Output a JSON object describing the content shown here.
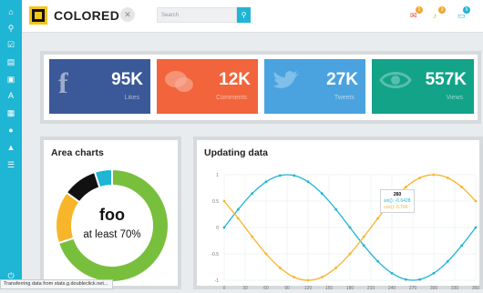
{
  "brand": {
    "name": "COLORED"
  },
  "search": {
    "placeholder": "Search"
  },
  "notifications": [
    {
      "icon": "mail-icon",
      "count": "2",
      "color": "#e84c3d"
    },
    {
      "icon": "bell-icon",
      "count": "3",
      "color": "#f0a92e"
    },
    {
      "icon": "chat-icon",
      "count": "9",
      "color": "#1fb5d4"
    }
  ],
  "sidebar": {
    "items": [
      "home-icon",
      "share-icon",
      "check-icon",
      "file-icon",
      "image-icon",
      "font-icon",
      "table-icon",
      "map-marker-icon",
      "warning-icon",
      "list-icon",
      "power-icon"
    ]
  },
  "stats": [
    {
      "value": "95K",
      "label": "Likes",
      "icon": "facebook-icon",
      "color": "#3b5998"
    },
    {
      "value": "12K",
      "label": "Comments",
      "icon": "comments-icon",
      "color": "#f2643b"
    },
    {
      "value": "27K",
      "label": "Tweets",
      "icon": "twitter-icon",
      "color": "#4aa3df"
    },
    {
      "value": "557K",
      "label": "Views",
      "icon": "eye-icon",
      "color": "#12a389"
    }
  ],
  "area_panel": {
    "title": "Area charts",
    "center_main": "foo",
    "center_sub": "at least 70%"
  },
  "updating_panel": {
    "title": "Updating data",
    "tooltip": {
      "x": "260",
      "sin": "sin(): -0.6428",
      "cos": "cos(): 0.766"
    }
  },
  "status_bar": {
    "text": "Transferring data from stats.g.doubleclick.net..."
  },
  "chart_data": [
    {
      "type": "pie",
      "title": "",
      "slices": [
        {
          "value": 70,
          "color": "#79bf3e"
        },
        {
          "value": 15,
          "color": "#f7b52a"
        },
        {
          "value": 10,
          "color": "#111111"
        },
        {
          "value": 5,
          "color": "#1fb5d4"
        }
      ]
    },
    {
      "type": "line",
      "title": "",
      "x": [
        0,
        20,
        40,
        60,
        80,
        100,
        120,
        140,
        160,
        180,
        200,
        220,
        240,
        260,
        280,
        300,
        320,
        340,
        360
      ],
      "x_tick_labels": [
        "0",
        "30",
        "60",
        "90",
        "120",
        "150",
        "180",
        "210",
        "240",
        "270",
        "300",
        "330",
        "360"
      ],
      "xlim": [
        0,
        360
      ],
      "ylim": [
        -1,
        1
      ],
      "y_ticks": [
        1,
        0.5,
        0,
        -0.5,
        -1
      ],
      "series": [
        {
          "color": "#1fb5d4",
          "values": [
            0,
            0.342,
            0.643,
            0.866,
            0.985,
            0.985,
            0.866,
            0.643,
            0.342,
            0,
            -0.342,
            -0.643,
            -0.866,
            -0.985,
            -0.985,
            -0.866,
            -0.643,
            -0.342,
            0
          ]
        },
        {
          "color": "#f7b52a",
          "values": [
            0.5,
            0.174,
            -0.174,
            -0.5,
            -0.766,
            -0.94,
            -1.0,
            -0.94,
            -0.766,
            -0.5,
            -0.174,
            0.174,
            0.5,
            0.766,
            0.94,
            1.0,
            0.94,
            0.766,
            0.5
          ]
        }
      ]
    }
  ]
}
